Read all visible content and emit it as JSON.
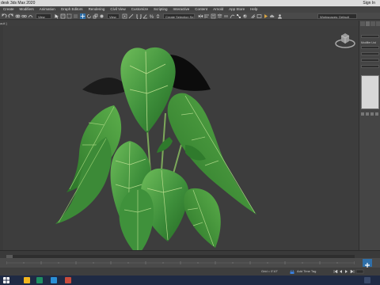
{
  "window": {
    "title": "Autodesk 3ds Max 2020",
    "title_visible": "desk 3ds Max 2020",
    "signin": "Sign In"
  },
  "menu": [
    "Create",
    "Modifiers",
    "Animation",
    "Graph Editors",
    "Rendering",
    "Civil View",
    "Customize",
    "Scripting",
    "Interactive",
    "Content",
    "Arnold",
    "App Store",
    "Help"
  ],
  "toolbar": {
    "view_dropdown": "View",
    "selection_set": "Create Selection Se",
    "workspace": "Workspaces: Default"
  },
  "viewport": {
    "label": "[Perspective] [Standard] [Default Shading]",
    "label_visible": "ault ]"
  },
  "command_panel": {
    "modifier_list": "Modifier List"
  },
  "statusbar": {
    "prompt": "Grid = 0'10\"",
    "add_time_tag": "Add Time Tag",
    "frame": "0 / 100"
  },
  "colors": {
    "leaf": "#3e8f3b",
    "leaf_dark": "#24601f",
    "viewport_bg": "#3d3d3d",
    "ui_panel": "#454545",
    "taskbar": "#1f2a44"
  }
}
